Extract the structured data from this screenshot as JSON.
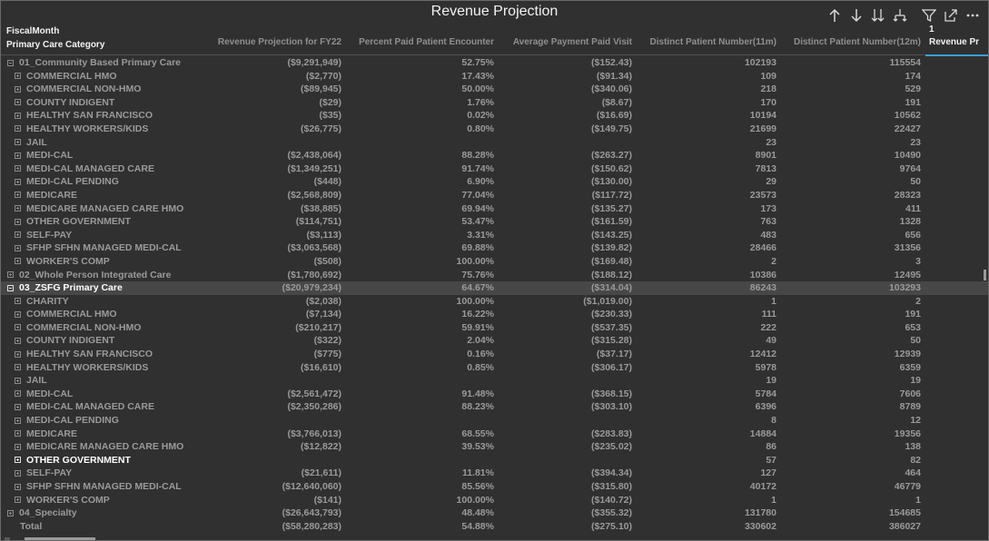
{
  "title": "Revenue Projection",
  "toolbar": {
    "icons": [
      "drill-up-icon",
      "drill-down-icon",
      "expand-all-icon",
      "expand-hierarchy-icon",
      "filter-icon",
      "focus-mode-icon",
      "more-options-icon"
    ]
  },
  "header": {
    "row_field_1": "FiscalMonth",
    "row_field_2": "Primary Care Category",
    "month_value": "1",
    "columns": [
      "Revenue Projection for FY22",
      "Percent Paid Patient Encounter",
      "Average Payment Paid Visit",
      "Distinct Patient Number(11m)",
      "Distinct Patient Number(12m)",
      "Revenue Pr"
    ]
  },
  "rows": [
    {
      "level": 1,
      "label": "01_Community Based Primary Care",
      "toggle": "minus",
      "v": [
        "($9,291,949)",
        "52.75%",
        "($152.43)",
        "102193",
        "115554"
      ]
    },
    {
      "level": 2,
      "label": "COMMERCIAL HMO",
      "toggle": "plus",
      "v": [
        "($2,770)",
        "17.43%",
        "($91.34)",
        "109",
        "174"
      ]
    },
    {
      "level": 2,
      "label": "COMMERCIAL NON-HMO",
      "toggle": "plus",
      "v": [
        "($89,945)",
        "50.00%",
        "($340.06)",
        "218",
        "529"
      ]
    },
    {
      "level": 2,
      "label": "COUNTY INDIGENT",
      "toggle": "plus",
      "v": [
        "($29)",
        "1.76%",
        "($8.67)",
        "170",
        "191"
      ]
    },
    {
      "level": 2,
      "label": "HEALTHY SAN FRANCISCO",
      "toggle": "plus",
      "v": [
        "($35)",
        "0.02%",
        "($16.69)",
        "10194",
        "10562"
      ]
    },
    {
      "level": 2,
      "label": "HEALTHY WORKERS/KIDS",
      "toggle": "plus",
      "v": [
        "($26,775)",
        "0.80%",
        "($149.75)",
        "21699",
        "22427"
      ]
    },
    {
      "level": 2,
      "label": "JAIL",
      "toggle": "plus",
      "v": [
        "",
        "",
        "",
        "23",
        "23"
      ]
    },
    {
      "level": 2,
      "label": "MEDI-CAL",
      "toggle": "plus",
      "v": [
        "($2,438,064)",
        "88.28%",
        "($263.27)",
        "8901",
        "10490"
      ]
    },
    {
      "level": 2,
      "label": "MEDI-CAL MANAGED CARE",
      "toggle": "plus",
      "v": [
        "($1,349,251)",
        "91.74%",
        "($150.62)",
        "7813",
        "9764"
      ]
    },
    {
      "level": 2,
      "label": "MEDI-CAL PENDING",
      "toggle": "plus",
      "v": [
        "($448)",
        "6.90%",
        "($130.00)",
        "29",
        "50"
      ]
    },
    {
      "level": 2,
      "label": "MEDICARE",
      "toggle": "plus",
      "v": [
        "($2,568,809)",
        "77.04%",
        "($117.72)",
        "23573",
        "28323"
      ]
    },
    {
      "level": 2,
      "label": "MEDICARE MANAGED CARE HMO",
      "toggle": "plus",
      "v": [
        "($38,885)",
        "69.94%",
        "($135.27)",
        "173",
        "411"
      ]
    },
    {
      "level": 2,
      "label": "OTHER GOVERNMENT",
      "toggle": "plus",
      "v": [
        "($114,751)",
        "53.47%",
        "($161.59)",
        "763",
        "1328"
      ]
    },
    {
      "level": 2,
      "label": "SELF-PAY",
      "toggle": "plus",
      "v": [
        "($3,113)",
        "3.31%",
        "($143.25)",
        "483",
        "656"
      ]
    },
    {
      "level": 2,
      "label": "SFHP SFHN MANAGED MEDI-CAL",
      "toggle": "plus",
      "v": [
        "($3,063,568)",
        "69.88%",
        "($139.82)",
        "28466",
        "31356"
      ]
    },
    {
      "level": 2,
      "label": "WORKER'S COMP",
      "toggle": "plus",
      "v": [
        "($508)",
        "100.00%",
        "($169.48)",
        "2",
        "3"
      ]
    },
    {
      "level": 1,
      "label": "02_Whole Person Integrated Care",
      "toggle": "plus",
      "v": [
        "($1,780,692)",
        "75.76%",
        "($188.12)",
        "10386",
        "12495"
      ]
    },
    {
      "level": 1,
      "label": "03_ZSFG Primary Care",
      "toggle": "minus",
      "selected": true,
      "v": [
        "($20,979,234)",
        "64.67%",
        "($314.04)",
        "86243",
        "103293"
      ]
    },
    {
      "level": 2,
      "label": "CHARITY",
      "toggle": "plus",
      "v": [
        "($2,038)",
        "100.00%",
        "($1,019.00)",
        "1",
        "2"
      ]
    },
    {
      "level": 2,
      "label": "COMMERCIAL HMO",
      "toggle": "plus",
      "v": [
        "($7,134)",
        "16.22%",
        "($230.33)",
        "111",
        "191"
      ]
    },
    {
      "level": 2,
      "label": "COMMERCIAL NON-HMO",
      "toggle": "plus",
      "v": [
        "($210,217)",
        "59.91%",
        "($537.35)",
        "222",
        "653"
      ]
    },
    {
      "level": 2,
      "label": "COUNTY INDIGENT",
      "toggle": "plus",
      "v": [
        "($322)",
        "2.04%",
        "($315.28)",
        "49",
        "50"
      ]
    },
    {
      "level": 2,
      "label": "HEALTHY SAN FRANCISCO",
      "toggle": "plus",
      "v": [
        "($775)",
        "0.16%",
        "($37.17)",
        "12412",
        "12939"
      ]
    },
    {
      "level": 2,
      "label": "HEALTHY WORKERS/KIDS",
      "toggle": "plus",
      "v": [
        "($16,610)",
        "0.85%",
        "($306.17)",
        "5978",
        "6359"
      ]
    },
    {
      "level": 2,
      "label": "JAIL",
      "toggle": "plus",
      "v": [
        "",
        "",
        "",
        "19",
        "19"
      ]
    },
    {
      "level": 2,
      "label": "MEDI-CAL",
      "toggle": "plus",
      "v": [
        "($2,561,472)",
        "91.48%",
        "($368.15)",
        "5784",
        "7606"
      ]
    },
    {
      "level": 2,
      "label": "MEDI-CAL MANAGED CARE",
      "toggle": "plus",
      "v": [
        "($2,350,286)",
        "88.23%",
        "($303.10)",
        "6396",
        "8789"
      ]
    },
    {
      "level": 2,
      "label": "MEDI-CAL PENDING",
      "toggle": "plus",
      "v": [
        "",
        "",
        "",
        "8",
        "12"
      ]
    },
    {
      "level": 2,
      "label": "MEDICARE",
      "toggle": "plus",
      "v": [
        "($3,766,013)",
        "68.55%",
        "($283.83)",
        "14884",
        "19356"
      ]
    },
    {
      "level": 2,
      "label": "MEDICARE MANAGED CARE HMO",
      "toggle": "plus",
      "v": [
        "($12,822)",
        "39.53%",
        "($235.02)",
        "86",
        "138"
      ]
    },
    {
      "level": 2,
      "label": "OTHER GOVERNMENT",
      "toggle": "plus",
      "white": true,
      "v": [
        "",
        "",
        "",
        "57",
        "82"
      ]
    },
    {
      "level": 2,
      "label": "SELF-PAY",
      "toggle": "plus",
      "v": [
        "($21,611)",
        "11.81%",
        "($394.34)",
        "127",
        "464"
      ]
    },
    {
      "level": 2,
      "label": "SFHP SFHN MANAGED MEDI-CAL",
      "toggle": "plus",
      "v": [
        "($12,640,060)",
        "85.56%",
        "($315.80)",
        "40172",
        "46779"
      ]
    },
    {
      "level": 2,
      "label": "WORKER'S COMP",
      "toggle": "plus",
      "v": [
        "($141)",
        "100.00%",
        "($140.72)",
        "1",
        "1"
      ]
    },
    {
      "level": 1,
      "label": "04_Specialty",
      "toggle": "plus",
      "v": [
        "($26,643,793)",
        "48.48%",
        "($355.32)",
        "131780",
        "154685"
      ]
    },
    {
      "level": 0,
      "label": "Total",
      "toggle": "none",
      "total": true,
      "v": [
        "($58,280,283)",
        "54.88%",
        "($275.10)",
        "330602",
        "386027"
      ]
    }
  ]
}
